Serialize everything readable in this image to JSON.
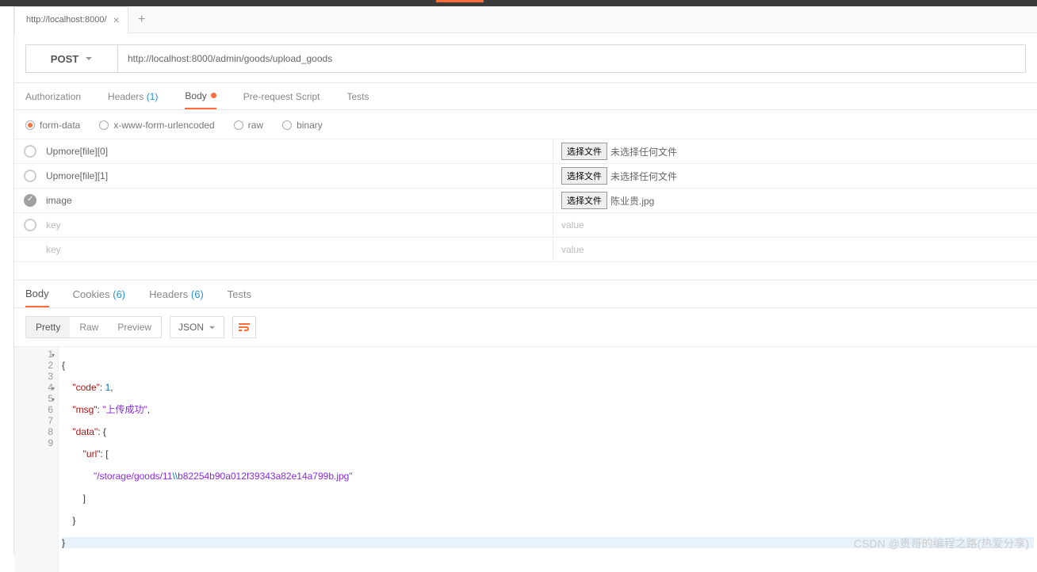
{
  "tab": {
    "title": "http://localhost:8000/"
  },
  "request": {
    "method": "POST",
    "url": "http://localhost:8000/admin/goods/upload_goods"
  },
  "reqTabs": {
    "auth": "Authorization",
    "headers": "Headers",
    "headersCount": "(1)",
    "body": "Body",
    "prereq": "Pre-request Script",
    "tests": "Tests"
  },
  "bodyTypes": {
    "formdata": "form-data",
    "urlencoded": "x-www-form-urlencoded",
    "raw": "raw",
    "binary": "binary"
  },
  "fileBtn": "选择文件",
  "noFile": "未选择任何文件",
  "rows": [
    {
      "key": "Upmore[file][0]",
      "file": ""
    },
    {
      "key": "Upmore[file][1]",
      "file": ""
    },
    {
      "key": "image",
      "file": "陈业贵.jpg",
      "checked": true
    }
  ],
  "placeholders": {
    "key": "key",
    "value": "value"
  },
  "respTabs": {
    "body": "Body",
    "cookies": "Cookies",
    "cookiesCount": "(6)",
    "headers": "Headers",
    "headersCount": "(6)",
    "tests": "Tests"
  },
  "viewOpts": {
    "pretty": "Pretty",
    "raw": "Raw",
    "preview": "Preview",
    "json": "JSON"
  },
  "response": {
    "l1": "{",
    "l2a": "    \"code\"",
    "l2b": ": ",
    "l2c": "1",
    "l2d": ",",
    "l3a": "    \"msg\"",
    "l3b": ": ",
    "l3c": "\"上传成功\"",
    "l3d": ",",
    "l4a": "    \"data\"",
    "l4b": ": {",
    "l5a": "        \"url\"",
    "l5b": ": [",
    "l6a": "            \"/storage/goods/11",
    "l6b": "\\\\",
    "l6c": "b82254b90a012f39343a82e14a799b.jpg\"",
    "l7": "        ]",
    "l8": "    }",
    "l9": "}"
  },
  "watermark": "CSDN @贵哥的编程之路(热爱分享)"
}
